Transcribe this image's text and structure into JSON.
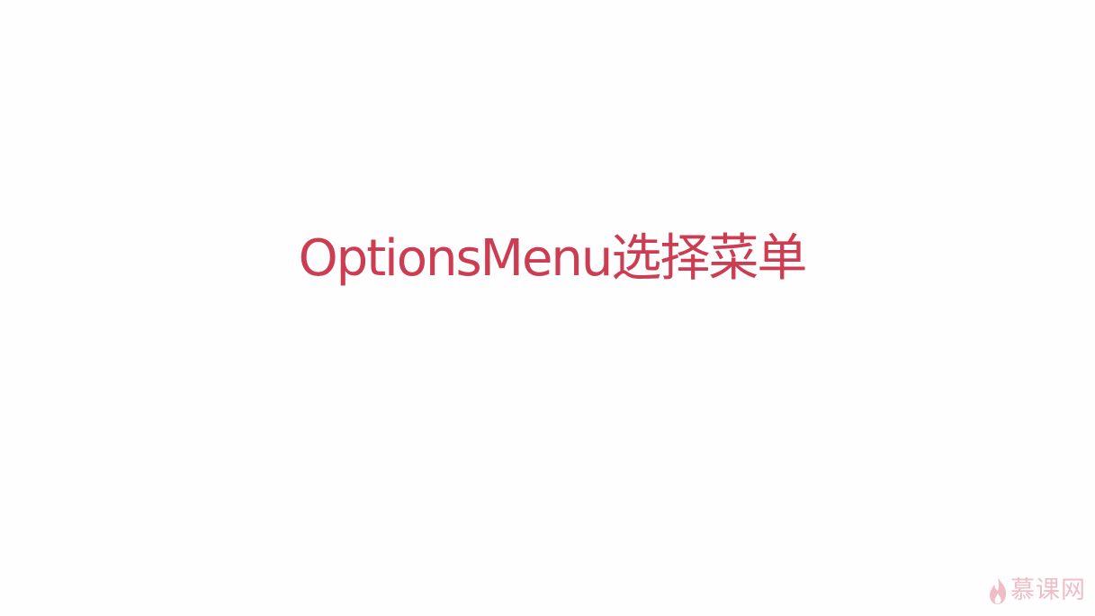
{
  "slide": {
    "title": "OptionsMenu选择菜单",
    "title_color": "#cc3d52"
  },
  "watermark": {
    "icon": "flame-icon",
    "text": "慕课网",
    "color": "#d2475c"
  }
}
